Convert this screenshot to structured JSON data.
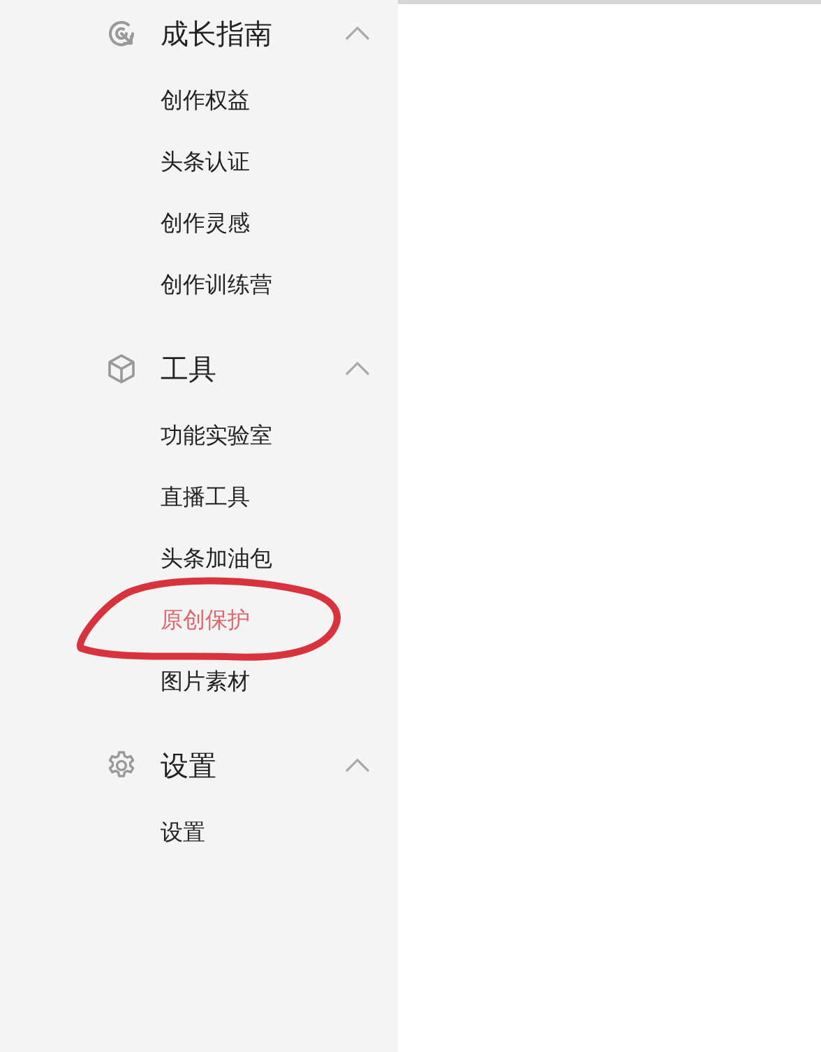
{
  "sidebar": {
    "sections": [
      {
        "title": "成长指南",
        "kind": "guide",
        "expanded": true,
        "items": [
          {
            "label": "创作权益",
            "selected": false,
            "circled": false
          },
          {
            "label": "头条认证",
            "selected": false,
            "circled": false
          },
          {
            "label": "创作灵感",
            "selected": false,
            "circled": false
          },
          {
            "label": "创作训练营",
            "selected": false,
            "circled": false
          }
        ]
      },
      {
        "title": "工具",
        "kind": "tools",
        "expanded": true,
        "items": [
          {
            "label": "功能实验室",
            "selected": false,
            "circled": false
          },
          {
            "label": "直播工具",
            "selected": false,
            "circled": false
          },
          {
            "label": "头条加油包",
            "selected": false,
            "circled": false
          },
          {
            "label": "原创保护",
            "selected": true,
            "circled": true
          },
          {
            "label": "图片素材",
            "selected": false,
            "circled": false
          }
        ]
      },
      {
        "title": "设置",
        "kind": "settings",
        "expanded": true,
        "items": [
          {
            "label": "设置",
            "selected": false,
            "circled": false
          }
        ]
      }
    ]
  }
}
